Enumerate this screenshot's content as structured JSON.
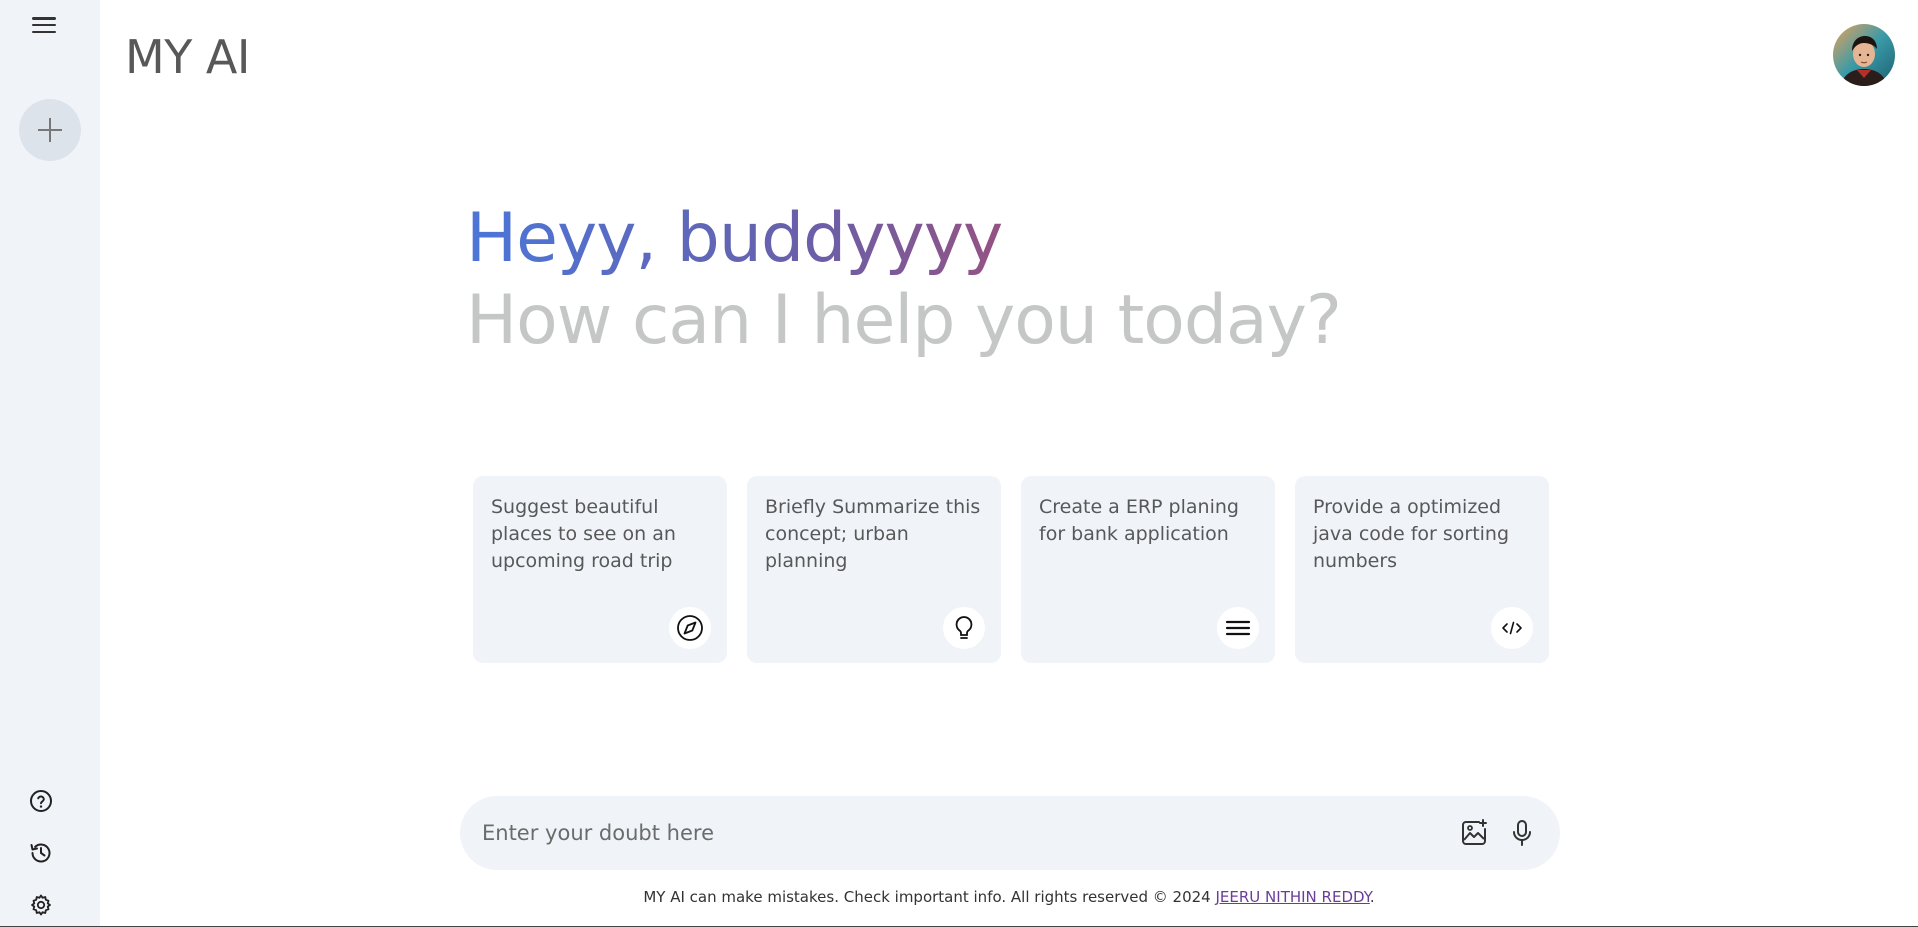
{
  "app": {
    "title": "MY AI"
  },
  "sidebar": {
    "menu_icon": "hamburger-icon",
    "new_chat_icon": "plus-icon",
    "bottom_icons": [
      "help-icon",
      "history-icon",
      "settings-icon"
    ]
  },
  "greeting": {
    "hello": "Heyy, buddyyyy",
    "subtitle": "How can I help you today?"
  },
  "cards": [
    {
      "text": "Suggest beautiful places to see on an upcoming road trip",
      "icon": "compass-icon"
    },
    {
      "text": "Briefly Summarize this concept; urban planning",
      "icon": "lightbulb-icon"
    },
    {
      "text": "Create a ERP planing for bank application",
      "icon": "menu-lines-icon"
    },
    {
      "text": "Provide a optimized java code for sorting numbers",
      "icon": "code-icon"
    }
  ],
  "prompt": {
    "placeholder": "Enter your doubt here",
    "gallery_icon": "image-add-icon",
    "mic_icon": "microphone-icon"
  },
  "footer": {
    "text": "MY AI can make mistakes. Check important info. All rights reserved © 2024 ",
    "link": "JEERU NITHIN REDDY",
    "suffix": "."
  },
  "colors": {
    "sidebar_bg": "#f0f4f9",
    "card_bg": "#f0f4f9",
    "greeting_start": "#4b76d8",
    "greeting_end": "#d9473a",
    "subtitle": "#c4c7c5",
    "link": "#6a3d9a"
  }
}
